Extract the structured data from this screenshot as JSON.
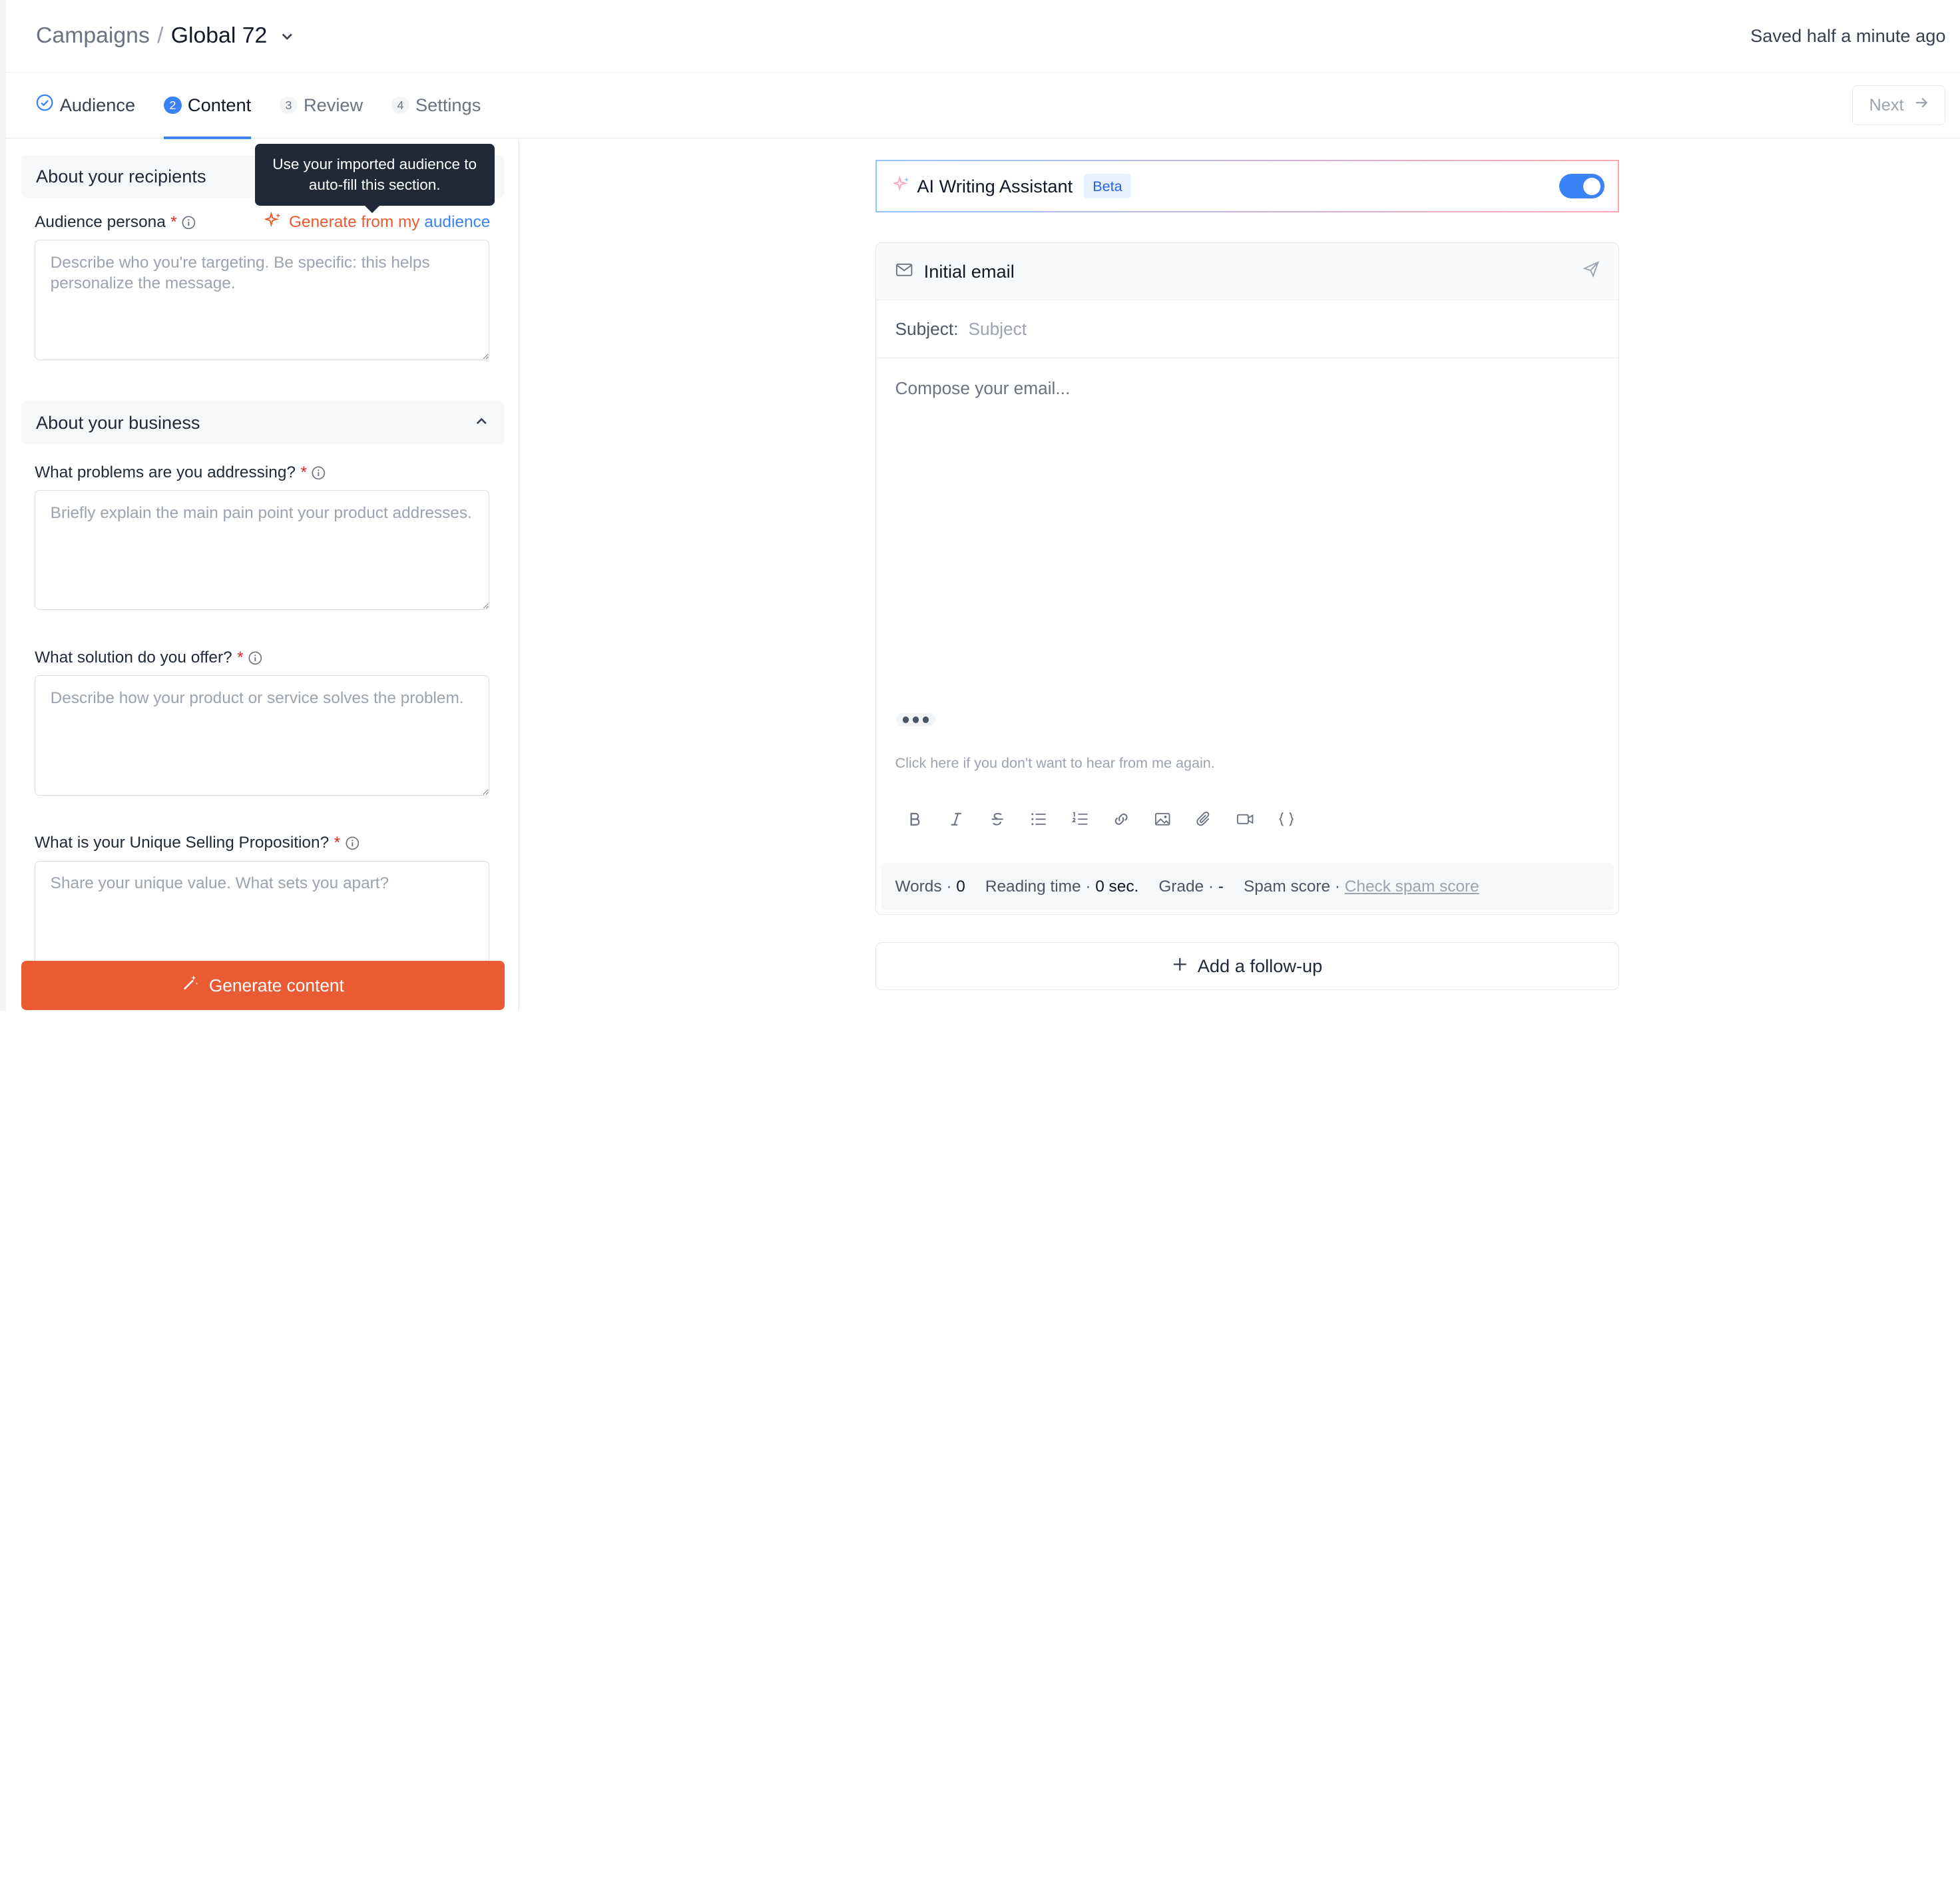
{
  "header": {
    "breadcrumb_root": "Campaigns",
    "breadcrumb_sep": "/",
    "campaign_name": "Global 72",
    "saved_status": "Saved half a minute ago"
  },
  "steps": [
    {
      "num": "",
      "label": "Audience",
      "state": "done"
    },
    {
      "num": "2",
      "label": "Content",
      "state": "active"
    },
    {
      "num": "3",
      "label": "Review",
      "state": "pending"
    },
    {
      "num": "4",
      "label": "Settings",
      "state": "pending"
    }
  ],
  "next_label": "Next",
  "left": {
    "recipients_title": "About your recipients",
    "tooltip": "Use your imported audience to auto-fill this section.",
    "persona_label": "Audience persona",
    "generate_link_a": "Generate from my ",
    "generate_link_b": "audience",
    "persona_placeholder": "Describe who you're targeting. Be specific: this helps personalize the message.",
    "business_title": "About your business",
    "problems_label": "What problems are you addressing?",
    "problems_placeholder": "Briefly explain the main pain point your product addresses.",
    "solution_label": "What solution do you offer?",
    "solution_placeholder": "Describe how your product or service solves the problem.",
    "usp_label": "What is your Unique Selling Proposition?",
    "usp_placeholder": "Share your unique value. What sets you apart?",
    "required_mark": "*",
    "generate_button": "Generate content"
  },
  "ai": {
    "title": "AI Writing Assistant",
    "badge": "Beta",
    "enabled": true
  },
  "email": {
    "title": "Initial email",
    "subject_label": "Subject:",
    "subject_placeholder": "Subject",
    "body_placeholder": "Compose your email...",
    "unsubscribe": "Click here if you don't want to hear from me again."
  },
  "stats": {
    "words_label": "Words · ",
    "words_value": "0",
    "reading_label": "Reading time · ",
    "reading_value": "0 sec.",
    "grade_label": "Grade · ",
    "grade_value": "-",
    "spam_label": "Spam score · ",
    "spam_link": "Check spam score"
  },
  "follow_up": "Add a follow-up",
  "colors": {
    "accent_blue": "#3b82f6",
    "accent_orange": "#ea5a33"
  }
}
